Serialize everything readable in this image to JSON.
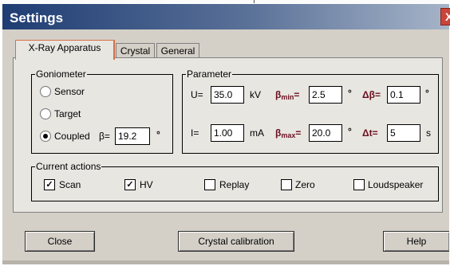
{
  "window": {
    "title": "Settings",
    "close_glyph": "X"
  },
  "tabs": [
    {
      "label": "X-Ray Apparatus",
      "active": true
    },
    {
      "label": "Crystal",
      "active": false
    },
    {
      "label": "General",
      "active": false
    }
  ],
  "goniometer": {
    "legend": "Goniometer",
    "sensor_label": "Sensor",
    "target_label": "Target",
    "coupled_label": "Coupled",
    "selected": "Coupled",
    "beta_label": "β=",
    "beta_value": "19.2",
    "beta_unit": "°"
  },
  "parameter": {
    "legend": "Parameter",
    "u_label": "U=",
    "u_value": "35.0",
    "u_unit": "kV",
    "i_label": "I=",
    "i_value": "1.00",
    "i_unit": "mA",
    "bmin_beta": "β",
    "bmin_sub": "min",
    "bmin_eq": "=",
    "bmin_value": "2.5",
    "bmin_unit": "°",
    "bmax_beta": "β",
    "bmax_sub": "max",
    "bmax_eq": "=",
    "bmax_value": "20.0",
    "bmax_unit": "°",
    "dbeta_label": "Δβ=",
    "dbeta_value": "0.1",
    "dbeta_unit": "°",
    "dt_label": "Δt=",
    "dt_value": "5",
    "dt_unit": "s"
  },
  "current_actions": {
    "legend": "Current actions",
    "items": [
      {
        "label": "Scan",
        "checked": true
      },
      {
        "label": "HV",
        "checked": true
      },
      {
        "label": "Replay",
        "checked": false
      },
      {
        "label": "Zero",
        "checked": false
      },
      {
        "label": "Loudspeaker",
        "checked": false
      }
    ]
  },
  "buttons": {
    "close": "Close",
    "calibration": "Crystal calibration",
    "help": "Help"
  },
  "colors": {
    "title_start": "#1f3d73",
    "title_end": "#a6b4c8",
    "face": "#d4d0c8",
    "panel": "#e8e6e1",
    "beta_accent": "#6a1020",
    "tab_highlight": "#d76f47"
  }
}
